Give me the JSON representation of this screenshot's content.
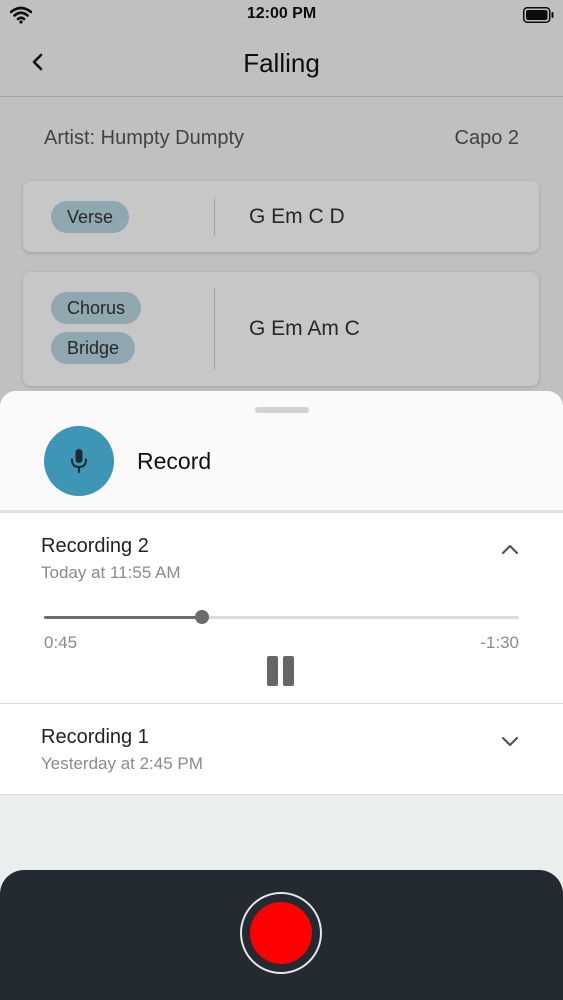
{
  "status_bar": {
    "time": "12:00 PM"
  },
  "nav": {
    "title": "Falling"
  },
  "song": {
    "artist": "Artist: Humpty Dumpty",
    "capo": "Capo 2",
    "sections": [
      {
        "tags": [
          "Verse"
        ],
        "chords": "G Em C D"
      },
      {
        "tags": [
          "Chorus",
          "Bridge"
        ],
        "chords": "G Em Am C"
      }
    ]
  },
  "sheet": {
    "record_label": "Record",
    "recordings": [
      {
        "name": "Recording 2",
        "date": "Today at 11:55 AM",
        "expanded": true,
        "elapsed": "0:45",
        "remaining": "-1:30",
        "progress": 0.333
      },
      {
        "name": "Recording 1",
        "date": "Yesterday at 2:45 PM",
        "expanded": false
      }
    ]
  },
  "colors": {
    "accent": "#3e95b5",
    "tag": "#b8d8e2",
    "record": "#ff0000",
    "bottom_bar": "#232a32"
  },
  "icons": {
    "wifi": "wifi-icon",
    "battery": "battery-icon",
    "back": "chevron-left-icon",
    "mic": "microphone-icon",
    "collapse": "chevron-up-icon",
    "expand": "chevron-down-icon",
    "pause": "pause-icon"
  }
}
